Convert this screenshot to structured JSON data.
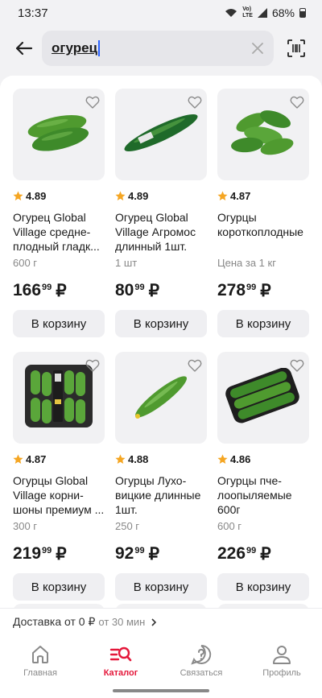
{
  "status": {
    "time": "13:37",
    "network": "Vo) LTE",
    "battery": "68%"
  },
  "search": {
    "query": "огурец"
  },
  "products": [
    {
      "rating": "4.89",
      "title": "Огурец Global Village средне-плодный гладк...",
      "unit": "600 г",
      "price_rub": "166",
      "price_kop": "99",
      "currency": "₽",
      "cart_label": "В корзину",
      "image": "two-cucumbers"
    },
    {
      "rating": "4.89",
      "title": "Огурец Global Village Агромос длинный 1шт.",
      "unit": "1 шт",
      "price_rub": "80",
      "price_kop": "99",
      "currency": "₽",
      "cart_label": "В корзину",
      "image": "long-cucumber-wrapped"
    },
    {
      "rating": "4.87",
      "title": "Огурцы короткоплодные",
      "unit": "Цена за 1 кг",
      "price_rub": "278",
      "price_kop": "99",
      "currency": "₽",
      "cart_label": "В корзину",
      "image": "cucumber-pile"
    },
    {
      "rating": "4.87",
      "title": "Огурцы Global Village корни-шоны премиум ...",
      "unit": "300 г",
      "price_rub": "219",
      "price_kop": "99",
      "currency": "₽",
      "cart_label": "В корзину",
      "image": "gherkins-tray"
    },
    {
      "rating": "4.88",
      "title": "Огурцы Лухо-вицкие длинные 1шт.",
      "unit": "250 г",
      "price_rub": "92",
      "price_kop": "99",
      "currency": "₽",
      "cart_label": "В корзину",
      "image": "single-long-cucumber"
    },
    {
      "rating": "4.86",
      "title": "Огурцы пче-лоопыляемые 600г",
      "unit": "600 г",
      "price_rub": "226",
      "price_kop": "99",
      "currency": "₽",
      "cart_label": "В корзину",
      "image": "cucumbers-tray"
    }
  ],
  "delivery": {
    "main": "Доставка от 0 ₽",
    "sub": "от 30 мин"
  },
  "tabs": [
    {
      "label": "Главная",
      "icon": "home-icon",
      "active": false
    },
    {
      "label": "Каталог",
      "icon": "catalog-search-icon",
      "active": true
    },
    {
      "label": "Связаться",
      "icon": "help-icon",
      "active": false
    },
    {
      "label": "Профиль",
      "icon": "profile-icon",
      "active": false
    }
  ],
  "colors": {
    "accent": "#e4173a",
    "star": "#f5a623",
    "cucumber": "#3e8a2a"
  }
}
